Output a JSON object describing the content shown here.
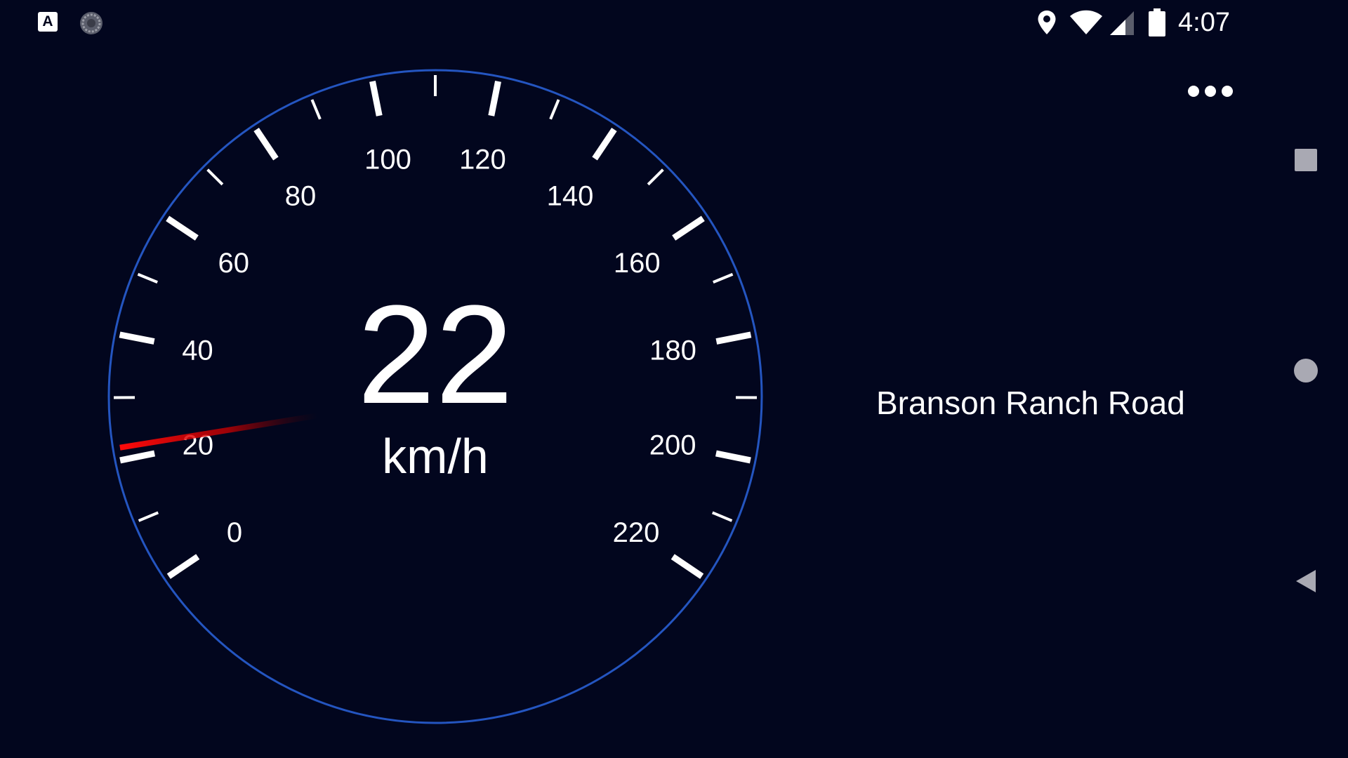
{
  "status_bar": {
    "notifications": [
      "a-badge-icon",
      "sync-icon"
    ],
    "system_icons": [
      "location-icon",
      "wifi-icon",
      "signal-icon",
      "battery-icon"
    ],
    "time": "4:07"
  },
  "menu": {
    "icon": "more-horizontal-icon"
  },
  "speedometer": {
    "speed": "22",
    "unit": "km/h",
    "needle_value": 22,
    "min": 0,
    "max": 220,
    "scale_labels": [
      "0",
      "20",
      "40",
      "60",
      "80",
      "100",
      "120",
      "140",
      "160",
      "180",
      "200",
      "220"
    ],
    "ring_color": "#2455c0",
    "needle_color": "#ff0a0a",
    "tick_color": "#ffffff"
  },
  "location": {
    "road_name": "Branson Ranch Road"
  },
  "nav_bar": {
    "buttons": [
      "recents-icon",
      "home-icon",
      "back-icon"
    ],
    "color": "#a9a9b3"
  },
  "colors": {
    "background": "#02061e"
  }
}
